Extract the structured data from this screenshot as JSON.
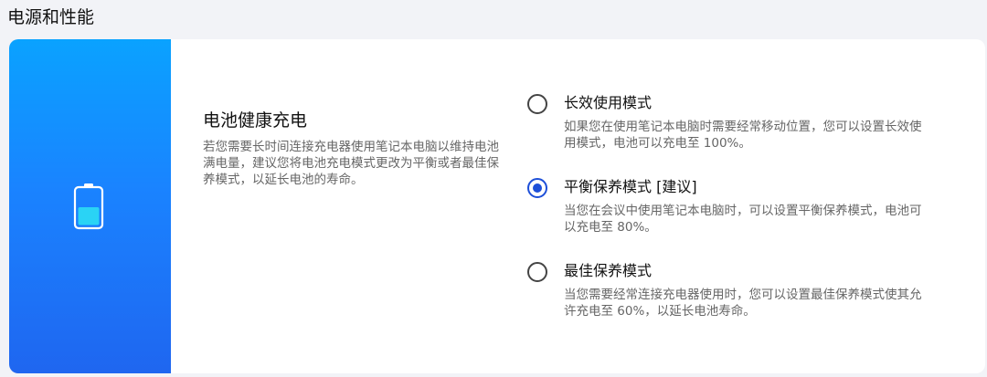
{
  "section": {
    "title": "电源和性能"
  },
  "card": {
    "icon": "battery-icon",
    "feature_title": "电池健康充电",
    "feature_desc": "若您需要长时间连接充电器使用笔记本电脑以维持电池满电量，建议您将电池充电模式更改为平衡或者最佳保养模式，以延长电池的寿命。",
    "options": [
      {
        "title": "长效使用模式",
        "desc": "如果您在使用笔记本电脑时需要经常移动位置，您可以设置长效使用模式，电池可以充电至 100%。",
        "selected": false
      },
      {
        "title": "平衡保养模式 [建议]",
        "desc": "当您在会议中使用笔记本电脑时，可以设置平衡保养模式，电池可以充电至 80%。",
        "selected": true
      },
      {
        "title": "最佳保养模式",
        "desc": "当您需要经常连接充电器使用时，您可以设置最佳保养模式使其允许充电至 60%，以延长电池寿命。",
        "selected": false
      }
    ]
  },
  "colors": {
    "accent": "#1d4fd8",
    "banner_top": "#0aa2ff",
    "banner_bottom": "#1f66f0",
    "battery_fill": "#2ad3f5"
  }
}
